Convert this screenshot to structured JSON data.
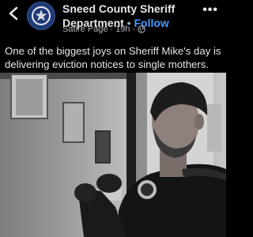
{
  "header": {
    "page_name": "Sneed County Sheriff",
    "page_name_line2": "Department",
    "separator": " • ",
    "follow_label": "Follow",
    "meta_label": "Satire Page",
    "meta_dot": "·",
    "meta_time": "19h",
    "meta_dot2": "·",
    "audience_icon": "globe-icon",
    "more_icon": "more-options-icon"
  },
  "post": {
    "caption": "One of the biggest joys on Sheriff Mike's day is delivering eviction notices to single mothers."
  },
  "colors": {
    "background": "#000000",
    "text": "#e4e6eb",
    "follow": "#4599ff",
    "meta": "#b0b3b8"
  }
}
